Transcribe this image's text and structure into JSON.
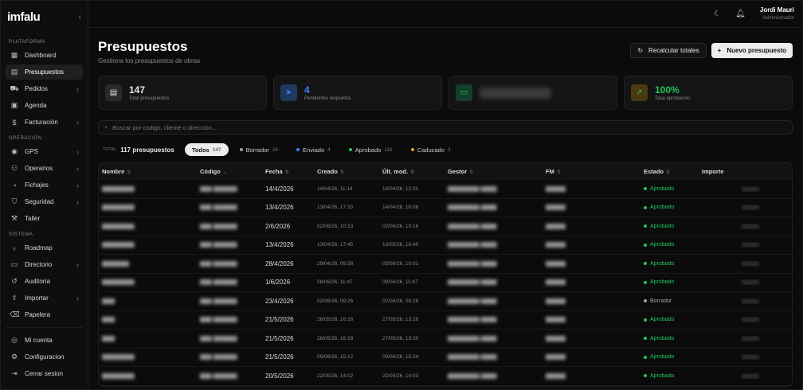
{
  "sidebar": {
    "logo": "imfalu",
    "sections": [
      {
        "title": "PLATAFORMA",
        "items": [
          {
            "label": "Dashboard",
            "icon": "dashboard-icon",
            "glyph": "▦",
            "chev": false,
            "active": false
          },
          {
            "label": "Presupuestos",
            "icon": "document-icon",
            "glyph": "▤",
            "chev": false,
            "active": true
          },
          {
            "label": "Pedidos",
            "icon": "cart-icon",
            "glyph": "⛟",
            "chev": true,
            "active": false
          },
          {
            "label": "Agenda",
            "icon": "calendar-icon",
            "glyph": "▣",
            "chev": false,
            "active": false
          },
          {
            "label": "Facturación",
            "icon": "invoice-icon",
            "glyph": "$",
            "chev": true,
            "active": false
          }
        ]
      },
      {
        "title": "OPERACIÓN",
        "items": [
          {
            "label": "GPS",
            "icon": "map-pin-icon",
            "glyph": "◉",
            "chev": true,
            "active": false
          },
          {
            "label": "Operarios",
            "icon": "users-icon",
            "glyph": "⚇",
            "chev": true,
            "active": false
          },
          {
            "label": "Fichajes",
            "icon": "clock-icon",
            "glyph": "◔",
            "chev": true,
            "active": false
          },
          {
            "label": "Seguridad",
            "icon": "shield-icon",
            "glyph": "⛉",
            "chev": true,
            "active": false
          },
          {
            "label": "Taller",
            "icon": "wrench-icon",
            "glyph": "⚒",
            "chev": false,
            "active": false
          }
        ]
      },
      {
        "title": "SISTEMA",
        "items": [
          {
            "label": "Roadmap",
            "icon": "lightbulb-icon",
            "glyph": "♁",
            "chev": false,
            "active": false
          },
          {
            "label": "Directorio",
            "icon": "folder-icon",
            "glyph": "▭",
            "chev": true,
            "active": false
          },
          {
            "label": "Auditoría",
            "icon": "history-icon",
            "glyph": "↺",
            "chev": false,
            "active": false
          },
          {
            "label": "Importar",
            "icon": "upload-icon",
            "glyph": "⇪",
            "chev": true,
            "active": false
          },
          {
            "label": "Papelera",
            "icon": "trash-icon",
            "glyph": "⌫",
            "chev": false,
            "active": false
          }
        ]
      }
    ],
    "bottom": [
      {
        "label": "Mi cuenta",
        "icon": "account-icon",
        "glyph": "◎"
      },
      {
        "label": "Configuracion",
        "icon": "gear-icon",
        "glyph": "⚙"
      },
      {
        "label": "Cerrar sesion",
        "icon": "logout-icon",
        "glyph": "⇥"
      }
    ]
  },
  "topbar": {
    "user_name": "Jordi Mauri",
    "user_role": "Administrador"
  },
  "page": {
    "title": "Presupuestos",
    "subtitle": "Gestiona los presupuestos de obras",
    "recalc_label": "Recalcular totales",
    "new_label": "Nuevo presupuesto"
  },
  "stats": [
    {
      "value": "147",
      "label": "Total presupuestos",
      "icon": "document-icon",
      "color": "#e8e8e8",
      "bg": "#2a2a2a",
      "glyph": "▤"
    },
    {
      "value": "4",
      "label": "Pendientes respuesta",
      "icon": "send-icon",
      "color": "#3b82f6",
      "bg": "#1e3a5f",
      "glyph": "➤"
    },
    {
      "value": "",
      "label": "",
      "icon": "money-icon",
      "color": "#22c55e",
      "bg": "#14402a",
      "glyph": "▭"
    },
    {
      "value": "100%",
      "label": "Tasa aprobación",
      "icon": "trend-up-icon",
      "color": "#22c55e",
      "bg": "#4a3a10",
      "glyph": "↗"
    }
  ],
  "search": {
    "placeholder": "Buscar por codigo, cliente o direccion..."
  },
  "filters": {
    "total_label": "TOTAL",
    "total_value": "117 presupuestos",
    "chips": [
      {
        "label": "Todos",
        "count": "147",
        "color": "",
        "selected": true
      },
      {
        "label": "Borrador",
        "count": "24",
        "color": "#9ca3af",
        "selected": false
      },
      {
        "label": "Enviado",
        "count": "4",
        "color": "#3b82f6",
        "selected": false
      },
      {
        "label": "Aprobado",
        "count": "116",
        "color": "#22c55e",
        "selected": false
      },
      {
        "label": "Caducado",
        "count": "3",
        "color": "#f59e0b",
        "selected": false
      }
    ]
  },
  "table": {
    "headers": [
      "Nombre",
      "Código",
      "Fecha",
      "Creado",
      "Últ. mod.",
      "Gestor",
      "FM",
      "Estado",
      "Importe"
    ],
    "status_colors": {
      "Aprobado": "#22c55e",
      "Borrador": "#9ca3af"
    },
    "rows": [
      {
        "fecha": "14/4/2026",
        "creado": "14/04/26, 11:14",
        "ult": "14/04/26, 12:31",
        "estado": "Aprobado"
      },
      {
        "fecha": "13/4/2026",
        "creado": "13/04/26, 17:33",
        "ult": "14/04/26, 16:06",
        "estado": "Aprobado"
      },
      {
        "fecha": "2/6/2026",
        "creado": "02/06/26, 10:13",
        "ult": "02/06/26, 10:16",
        "estado": "Aprobado"
      },
      {
        "fecha": "13/4/2026",
        "creado": "13/04/26, 17:45",
        "ult": "13/05/26, 16:40",
        "estado": "Aprobado"
      },
      {
        "fecha": "28/4/2026",
        "creado": "29/04/26, 09:58",
        "ult": "05/06/26, 10:01",
        "estado": "Aprobado"
      },
      {
        "fecha": "1/6/2026",
        "creado": "08/06/26, 11:47",
        "ult": "08/06/26, 11:47",
        "estado": "Aprobado"
      },
      {
        "fecha": "23/4/2026",
        "creado": "02/06/26, 09:26",
        "ult": "02/06/26, 09:28",
        "estado": "Borrador"
      },
      {
        "fecha": "21/5/2026",
        "creado": "26/05/26, 16:16",
        "ult": "27/05/26, 13:29",
        "estado": "Aprobado"
      },
      {
        "fecha": "21/5/2026",
        "creado": "26/05/26, 16:18",
        "ult": "27/05/26, 13:30",
        "estado": "Aprobado"
      },
      {
        "fecha": "21/5/2026",
        "creado": "09/06/26, 15:12",
        "ult": "09/06/26, 15:24",
        "estado": "Aprobado"
      },
      {
        "fecha": "20/5/2026",
        "creado": "22/05/26, 14:02",
        "ult": "22/05/26, 14:03",
        "estado": "Aprobado"
      }
    ]
  }
}
